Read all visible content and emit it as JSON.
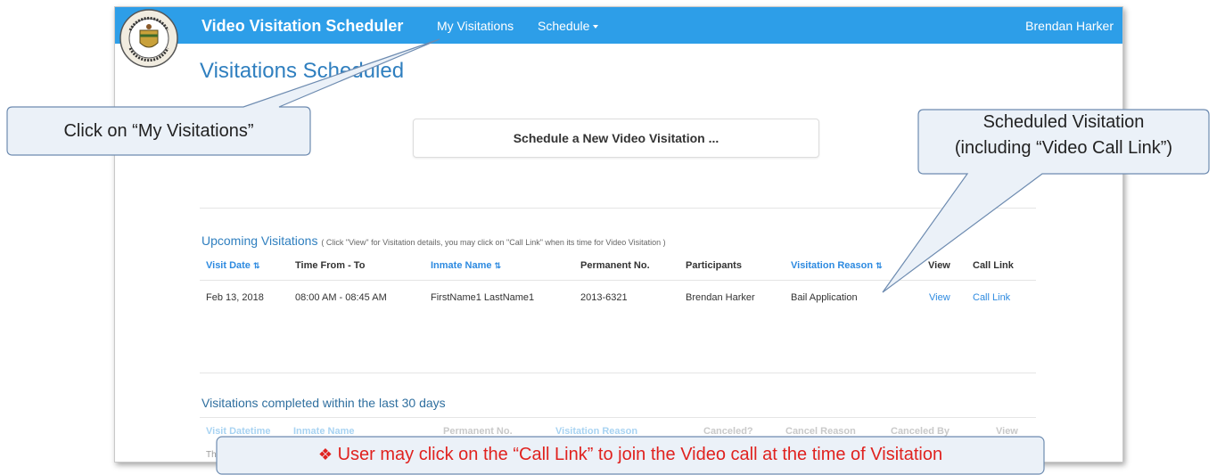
{
  "app": {
    "brand": "Video Visitation Scheduler",
    "nav": {
      "my_visitations": "My Visitations",
      "schedule": "Schedule"
    },
    "user": "Brendan Harker",
    "page_title": "Visitations Scheduled",
    "schedule_button": "Schedule a New Video Visitation ...",
    "accent_color": "#2d9ee8"
  },
  "upcoming": {
    "title": "Upcoming Visitations",
    "hint": "( Click \"View\" for Visitation details, you may click on \"Call Link\" when its time for Video Visitation )",
    "headers": [
      "Visit Date",
      "Time From - To",
      "Inmate Name",
      "Permanent No.",
      "Participants",
      "Visitation Reason",
      "View",
      "Call Link"
    ],
    "sort_icon": "⇅",
    "rows": [
      {
        "date": "Feb 13, 2018",
        "time": "08:00 AM - 08:45 AM",
        "inmate": "FirstName1 LastName1",
        "permanent_no": "2013-6321",
        "participants": "Brendan Harker",
        "reason": "Bail Application",
        "view": "View",
        "call_link": "Call Link"
      }
    ]
  },
  "completed": {
    "title": "Visitations completed within the last 30 days",
    "headers": [
      "Visit Datetime",
      "Inmate Name",
      "Permanent No.",
      "Visitation Reason",
      "Canceled?",
      "Cancel Reason",
      "Canceled By",
      "View"
    ],
    "partial_row_text": "The"
  },
  "callouts": {
    "my_visitations": "Click on “My Visitations”",
    "scheduled_line1": "Scheduled Visitation",
    "scheduled_line2": "(including “Video Call Link”)",
    "bottom_note": "User may click on the “Call Link” to join the Video call at the time of Visitation",
    "bottom_bullet": "❖"
  }
}
